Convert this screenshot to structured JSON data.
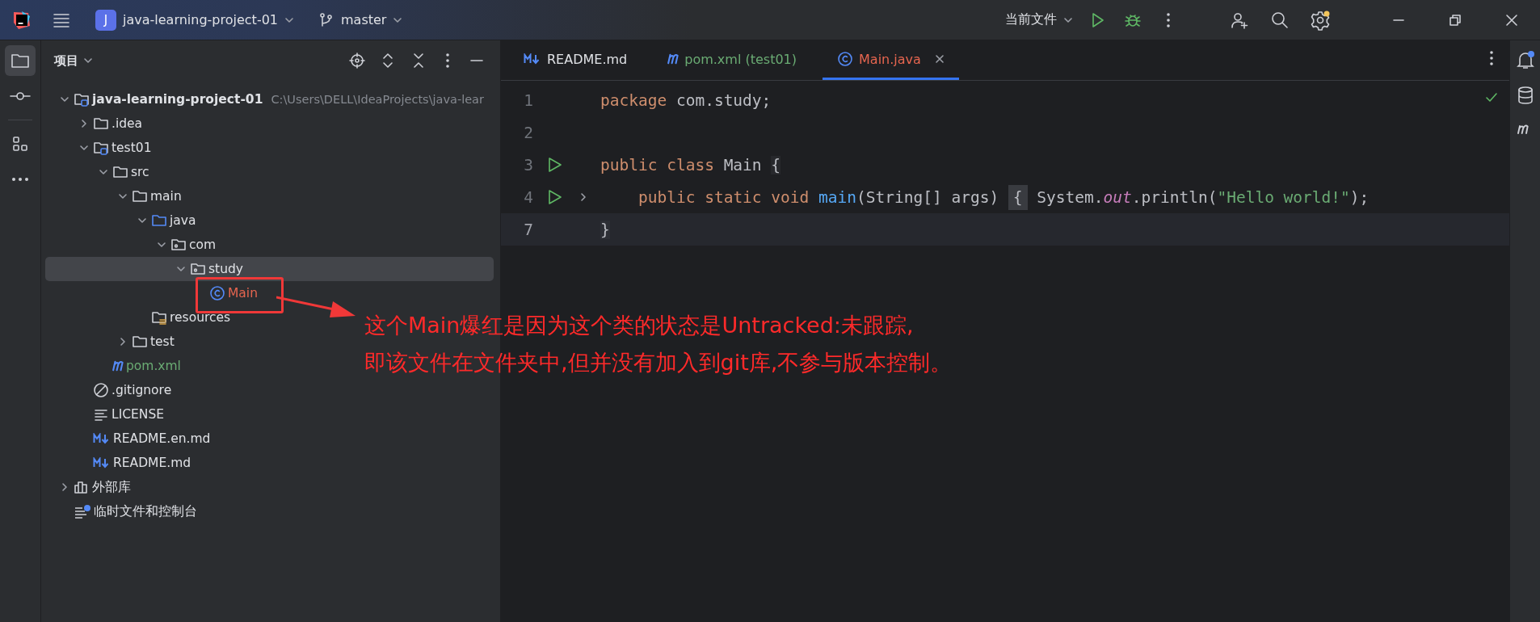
{
  "title_bar": {
    "project": {
      "badge": "J",
      "name": "java-learning-project-01"
    },
    "branch": "master",
    "run_config": "当前文件",
    "settings_notice": true
  },
  "project_panel": {
    "title": "项目",
    "tree": [
      {
        "label": "java-learning-project-01",
        "kind": "module",
        "bold": true,
        "path": "C:\\Users\\DELL\\IdeaProjects\\java-lear",
        "expanded": true,
        "selected": false,
        "children": [
          {
            "label": ".idea",
            "kind": "folder",
            "expanded": false,
            "selected": false
          },
          {
            "label": "test01",
            "kind": "module",
            "expanded": true,
            "selected": false,
            "children": [
              {
                "label": "src",
                "kind": "folder",
                "expanded": true,
                "selected": false,
                "children": [
                  {
                    "label": "main",
                    "kind": "folder",
                    "expanded": true,
                    "selected": false,
                    "children": [
                      {
                        "label": "java",
                        "kind": "source",
                        "expanded": true,
                        "selected": false,
                        "children": [
                          {
                            "label": "com",
                            "kind": "package",
                            "expanded": true,
                            "selected": false,
                            "children": [
                              {
                                "label": "study",
                                "kind": "package",
                                "expanded": true,
                                "selected": true,
                                "children": [
                                  {
                                    "label": "Main",
                                    "kind": "class",
                                    "color": "#e5654f",
                                    "selected": false
                                  }
                                ]
                              }
                            ]
                          }
                        ]
                      },
                      {
                        "label": "resources",
                        "kind": "resources",
                        "selected": false
                      }
                    ]
                  },
                  {
                    "label": "test",
                    "kind": "folder",
                    "expanded": false,
                    "selected": false
                  }
                ]
              },
              {
                "label": "pom.xml",
                "kind": "maven",
                "color": "#6aab73",
                "selected": false
              }
            ]
          },
          {
            "label": ".gitignore",
            "kind": "ignore",
            "selected": false
          },
          {
            "label": "LICENSE",
            "kind": "text",
            "selected": false
          },
          {
            "label": "README.en.md",
            "kind": "markdown",
            "selected": false
          },
          {
            "label": "README.md",
            "kind": "markdown",
            "selected": false
          }
        ]
      },
      {
        "label": "外部库",
        "kind": "library",
        "expanded": false,
        "selected": false
      },
      {
        "label": "临时文件和控制台",
        "kind": "scratch",
        "selected": false
      }
    ]
  },
  "editor": {
    "tabs": [
      {
        "label": "README.md",
        "kind": "markdown",
        "selected": false
      },
      {
        "label": "pom.xml (test01)",
        "kind": "maven",
        "color": "#6aab73",
        "selected": false
      },
      {
        "label": "Main.java",
        "kind": "class",
        "color": "#e5654f",
        "selected": true
      }
    ],
    "lines": [
      {
        "number": "1",
        "run": false,
        "fold": false,
        "current": false,
        "indented": false,
        "tokens": [
          {
            "kind": "keyword",
            "text": "package"
          },
          {
            "kind": "plain",
            "text": " com.study;"
          }
        ]
      },
      {
        "number": "2",
        "run": false,
        "fold": false,
        "current": false,
        "indented": false
      },
      {
        "number": "3",
        "run": true,
        "fold": false,
        "current": false,
        "indented": false,
        "tokens": [
          {
            "kind": "keyword",
            "text": "public class"
          },
          {
            "kind": "plain",
            "text": " Main "
          },
          {
            "kind": "brace",
            "text": "{"
          }
        ]
      },
      {
        "number": "4",
        "run": true,
        "fold": true,
        "current": false,
        "indented": true,
        "tokens": [
          {
            "kind": "keyword",
            "text": "public static void "
          },
          {
            "kind": "method",
            "text": "main"
          },
          {
            "kind": "plain",
            "text": "(String[] args) "
          },
          {
            "kind": "folded",
            "text": "{"
          },
          {
            "kind": "plain",
            "text": " System."
          },
          {
            "kind": "field",
            "text": "out"
          },
          {
            "kind": "plain",
            "text": ".println("
          },
          {
            "kind": "string",
            "text": "\"Hello world!\""
          },
          {
            "kind": "plain",
            "text": ");"
          }
        ]
      },
      {
        "number": "7",
        "run": false,
        "fold": false,
        "current": true,
        "indented": false,
        "tokens": [
          {
            "kind": "brace",
            "text": "}"
          }
        ]
      }
    ]
  },
  "annotation": {
    "lines": [
      "这个Main爆红是因为这个类的状态是Untracked:未跟踪,",
      "即该文件在文件夹中,但并没有加入到git库,不参与版本控制。"
    ]
  }
}
